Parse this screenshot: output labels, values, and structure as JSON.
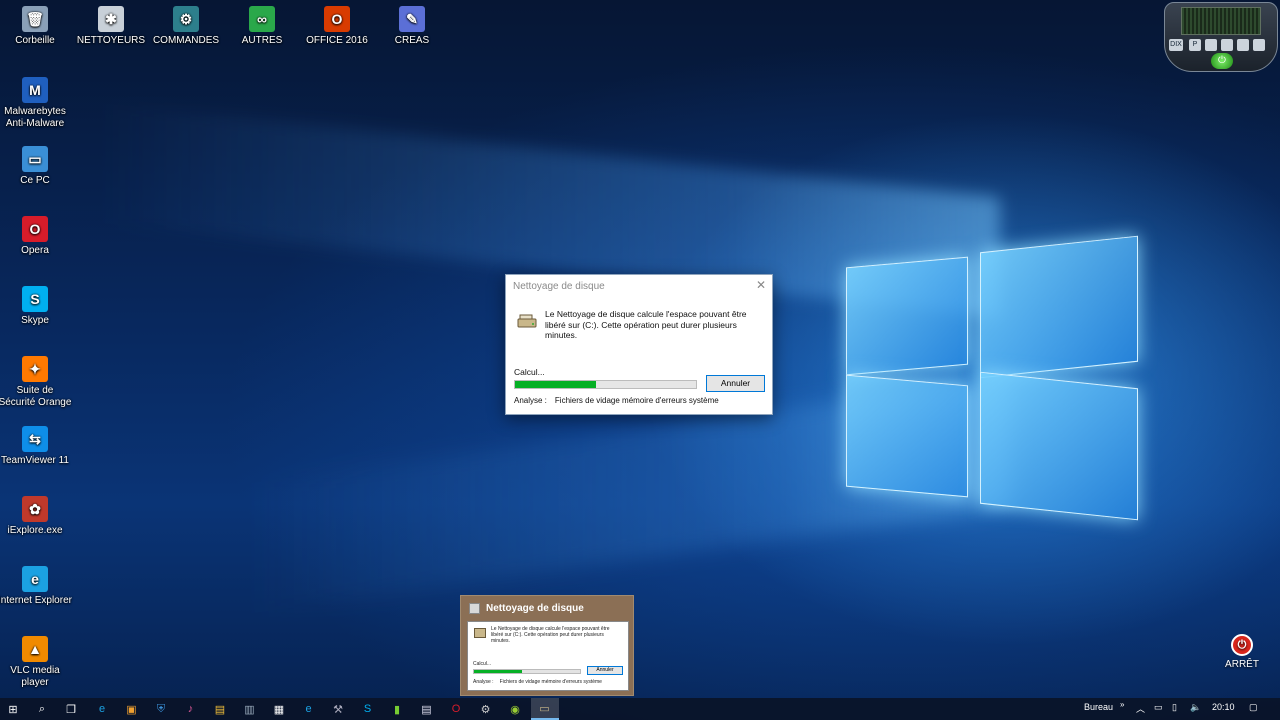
{
  "desktop_icons_top": [
    {
      "label": "Corbeille",
      "icon": "recycle-bin-icon",
      "glyph": "🗑",
      "color": "#8aa0b8"
    },
    {
      "label": "NETTOYEURS",
      "icon": "cleaners-folder-icon",
      "glyph": "✱",
      "color": "#c8d0d8"
    },
    {
      "label": "COMMANDES",
      "icon": "commands-folder-icon",
      "glyph": "⚙",
      "color": "#2d7f8c"
    },
    {
      "label": "AUTRES",
      "icon": "others-folder-icon",
      "glyph": "∞",
      "color": "#2aa84a"
    },
    {
      "label": "OFFICE 2016",
      "icon": "office-icon",
      "glyph": "O",
      "color": "#d83b01"
    },
    {
      "label": "CREAS",
      "icon": "creas-pencil-icon",
      "glyph": "✎",
      "color": "#5b6fd6"
    }
  ],
  "desktop_icons_left": [
    {
      "label": "Malwarebytes Anti-Malware",
      "icon": "malwarebytes-icon",
      "glyph": "M",
      "color": "#1f5fbf"
    },
    {
      "label": "Ce PC",
      "icon": "this-pc-icon",
      "glyph": "▭",
      "color": "#3a8fd6"
    },
    {
      "label": "Opera",
      "icon": "opera-icon",
      "glyph": "O",
      "color": "#d71c2a"
    },
    {
      "label": "Skype",
      "icon": "skype-icon",
      "glyph": "S",
      "color": "#00aff0"
    },
    {
      "label": "Suite de Sécurité Orange",
      "icon": "orange-security-icon",
      "glyph": "✦",
      "color": "#ff7900"
    },
    {
      "label": "TeamViewer 11",
      "icon": "teamviewer-icon",
      "glyph": "⇆",
      "color": "#0e8ee9"
    },
    {
      "label": "iExplore.exe",
      "icon": "iexplore-exe-icon",
      "glyph": "✿",
      "color": "#c0392b"
    },
    {
      "label": "Internet Explorer",
      "icon": "internet-explorer-icon",
      "glyph": "e",
      "color": "#1ba1e2"
    },
    {
      "label": "VLC media player",
      "icon": "vlc-icon",
      "glyph": "▲",
      "color": "#f08a00"
    }
  ],
  "dialog": {
    "title": "Nettoyage de disque",
    "message": "Le Nettoyage de disque calcule l'espace pouvant être libéré sur  (C:). Cette opération peut durer plusieurs minutes.",
    "status": "Calcul...",
    "progress": 0.45,
    "cancel_label": "Annuler",
    "analysis_label": "Analyse :",
    "analysis_value": "Fichiers de vidage mémoire d'erreurs système"
  },
  "preview": {
    "title": "Nettoyage de disque"
  },
  "arret_label": "ARRÊT",
  "gadget": {
    "btn1": "DIX",
    "btn2": "P"
  },
  "tray": {
    "bureau_label": "Bureau",
    "time": "20:10"
  },
  "taskbar_icons": [
    "start-icon",
    "search-icon",
    "task-view-icon",
    "edge-icon",
    "media-icon",
    "shield-icon",
    "music-icon",
    "file-explorer-icon",
    "monitor-icon",
    "cmd-icon",
    "ie-icon",
    "tool-icon",
    "skype-icon",
    "android-icon",
    "notepad-icon",
    "opera-icon",
    "settings-icon",
    "camera-icon",
    "disk-cleanup-icon"
  ]
}
